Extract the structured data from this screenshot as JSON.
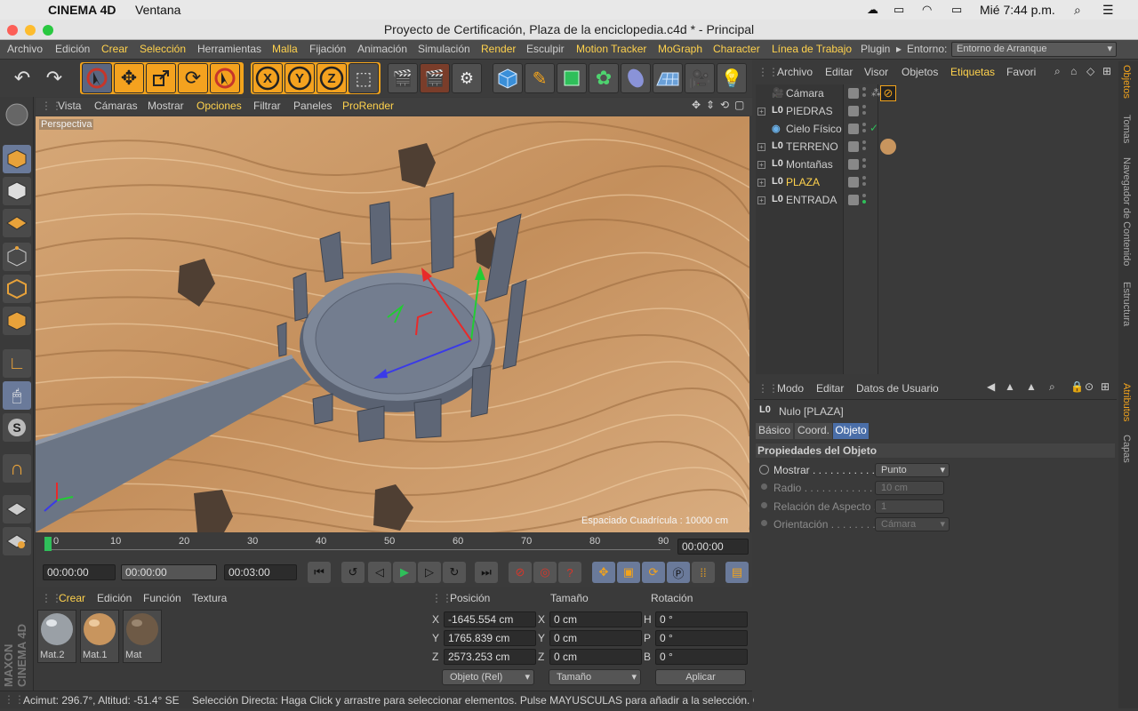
{
  "macbar": {
    "app": "CINEMA 4D",
    "menu": "Ventana",
    "clock": "Mié 7:44 p.m."
  },
  "window": {
    "title": "Proyecto de Certificación, Plaza de la enciclopedia.c4d * - Principal"
  },
  "menu": [
    "Archivo",
    "Edición",
    "Crear",
    "Selección",
    "Herramientas",
    "Malla",
    "Fijación",
    "Animación",
    "Simulación",
    "Render",
    "Esculpir",
    "Motion Tracker",
    "MoGraph",
    "Character",
    "Línea de Trabajo",
    "Plugin"
  ],
  "environment": {
    "label": "Entorno:",
    "value": "Entorno de Arranque"
  },
  "viewport": {
    "menu": [
      "Vista",
      "Cámaras",
      "Mostrar",
      "Opciones",
      "Filtrar",
      "Paneles",
      "ProRender"
    ],
    "label": "Perspectiva",
    "grid_info": "Espaciado Cuadrícula : 10000 cm"
  },
  "timeline": {
    "ticks": [
      "0",
      "10",
      "20",
      "30",
      "40",
      "50",
      "60",
      "70",
      "80",
      "90"
    ],
    "current_frame": "00:00:00"
  },
  "transport": {
    "start": "00:00:00",
    "preview": "00:00:00",
    "end": "00:03:00"
  },
  "materials": {
    "menu": [
      "Crear",
      "Edición",
      "Función",
      "Textura"
    ],
    "items": [
      {
        "name": "Mat.2",
        "color": "#9aa0a6"
      },
      {
        "name": "Mat.1",
        "color": "#c8955e"
      },
      {
        "name": "Mat",
        "color": "#6e5a46"
      }
    ]
  },
  "coords": {
    "headers": [
      "Posición",
      "Tamaño",
      "Rotación"
    ],
    "rows": [
      {
        "axis": "X",
        "pos": "-1645.554 cm",
        "size_axis": "X",
        "size": "0 cm",
        "rot_axis": "H",
        "rot": "0 °"
      },
      {
        "axis": "Y",
        "pos": "1765.839 cm",
        "size_axis": "Y",
        "size": "0 cm",
        "rot_axis": "P",
        "rot": "0 °"
      },
      {
        "axis": "Z",
        "pos": "2573.253 cm",
        "size_axis": "Z",
        "size": "0 cm",
        "rot_axis": "B",
        "rot": "0 °"
      }
    ],
    "mode": "Objeto (Rel)",
    "size_mode": "Tamaño",
    "apply": "Aplicar"
  },
  "status": {
    "left": "Acimut: 296.7°, Altitud: -51.4°  SE",
    "message": "Selección Directa: Haga Click y arrastre para seleccionar elementos. Pulse MAYUSCULAS para añadir a la selección. CTR"
  },
  "objmgr": {
    "menu": [
      "Archivo",
      "Editar",
      "Visor",
      "Objetos",
      "Etiquetas",
      "Favori"
    ],
    "objects": [
      {
        "name": "Cámara",
        "kind": "camera"
      },
      {
        "name": "PIEDRAS",
        "kind": "null"
      },
      {
        "name": "Cielo Físico",
        "kind": "sky"
      },
      {
        "name": "TERRENO",
        "kind": "null"
      },
      {
        "name": "Montañas",
        "kind": "null"
      },
      {
        "name": "PLAZA",
        "kind": "null",
        "selected": true
      },
      {
        "name": "ENTRADA",
        "kind": "null"
      }
    ]
  },
  "attrmgr": {
    "menu": [
      "Modo",
      "Editar",
      "Datos de Usuario"
    ],
    "object": "Nulo [PLAZA]",
    "tabs": [
      "Básico",
      "Coord.",
      "Objeto"
    ],
    "section": "Propiedades del Objeto",
    "props": [
      {
        "label": "Mostrar . . . . . . . . . . .",
        "value": "Punto",
        "enabled": true
      },
      {
        "label": "Radio . . . . . . . . . . . . .",
        "value": "10 cm",
        "enabled": false
      },
      {
        "label": "Relación de Aspecto . .",
        "value": "1",
        "enabled": false
      },
      {
        "label": "Orientación . . . . . . . .",
        "value": "Cámara",
        "enabled": false
      }
    ]
  },
  "dock": [
    "Objetos",
    "Tomas",
    "Navegador de Contenido",
    "Estructura",
    "Atributos",
    "Capas"
  ],
  "brand": "MAXON CINEMA 4D"
}
